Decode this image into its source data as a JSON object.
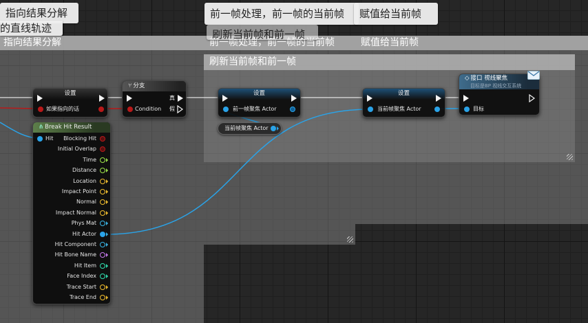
{
  "colors": {
    "exec": "#f2f2f2",
    "object_wire": "#2aa3e8",
    "bool_wire": "#b81919",
    "vector": "#f5c02e",
    "float": "#9fe64a",
    "struct": "#3ab6e8",
    "name": "#c97bf0",
    "int": "#30e0b0"
  },
  "comments": [
    {
      "header": "指向结果分解"
    },
    {
      "header": "前一帧处理，前一帧的当前帧"
    },
    {
      "header": "赋值给当前帧"
    },
    {
      "header": "刷新当前帧和前一帧"
    }
  ],
  "bubbles": [
    {
      "line1": "指向结果分解",
      "line2": "的直线轨迹"
    },
    {
      "text": "前一帧处理，前一帧的当前帧"
    },
    {
      "text": "刷新当前帧和前一帧"
    },
    {
      "text": "赋值给当前帧"
    }
  ],
  "nodes": {
    "set_bool": {
      "title": "设置",
      "var": "如果指向的话"
    },
    "branch": {
      "title": "分支",
      "condition": "Condition",
      "true": "真",
      "false": "假"
    },
    "break_hit": {
      "title": "Break Hit Result",
      "input": "Hit",
      "outputs": [
        {
          "label": "Blocking Hit",
          "type": "bool"
        },
        {
          "label": "Initial Overlap",
          "type": "bool"
        },
        {
          "label": "Time",
          "type": "float"
        },
        {
          "label": "Distance",
          "type": "float"
        },
        {
          "label": "Location",
          "type": "vector"
        },
        {
          "label": "Impact Point",
          "type": "vector"
        },
        {
          "label": "Normal",
          "type": "vector"
        },
        {
          "label": "Impact Normal",
          "type": "vector"
        },
        {
          "label": "Phys Mat",
          "type": "object"
        },
        {
          "label": "Hit Actor",
          "type": "object"
        },
        {
          "label": "Hit Component",
          "type": "object"
        },
        {
          "label": "Hit Bone Name",
          "type": "name"
        },
        {
          "label": "Hit Item",
          "type": "int"
        },
        {
          "label": "Face Index",
          "type": "int"
        },
        {
          "label": "Trace Start",
          "type": "vector"
        },
        {
          "label": "Trace End",
          "type": "vector"
        }
      ]
    },
    "set_prev": {
      "title": "设置",
      "var": "前一帧聚焦 Actor"
    },
    "get_current": {
      "label": "当前帧聚焦 Actor"
    },
    "set_current": {
      "title": "设置",
      "var": "当前帧聚焦 Actor"
    },
    "interface_call": {
      "title": "接口 视线聚焦",
      "subtitle": "目标是BP 视线交互系统",
      "target": "目标"
    }
  }
}
